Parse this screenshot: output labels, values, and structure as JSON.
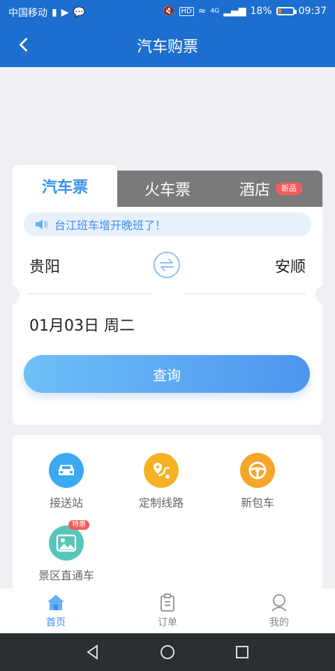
{
  "status_bar": {
    "carrier": "中国移动",
    "battery_percent": "18%",
    "time": "09:37",
    "network": "4G",
    "hd_label": "HD"
  },
  "header": {
    "title": "汽车购票"
  },
  "tabs": {
    "bus": "汽车票",
    "train": "火车票",
    "hotel": "酒店",
    "hotel_badge": "新品"
  },
  "notice": "台江班车增开晚班了！",
  "route": {
    "from": "贵阳",
    "to": "安顺"
  },
  "date": "01月03日 周二",
  "query_button": "查询",
  "services": [
    {
      "label": "接送站"
    },
    {
      "label": "定制线路"
    },
    {
      "label": "新包车"
    },
    {
      "label": "景区直通车",
      "tag": "特惠"
    }
  ],
  "bottom_tabs": [
    {
      "label": "首页",
      "active": true
    },
    {
      "label": "订单",
      "active": false
    },
    {
      "label": "我的",
      "active": false
    }
  ],
  "colors": {
    "accent": "#3b8ef0",
    "header_bg": "#1c6ecf",
    "badge_red": "#f55c5c"
  }
}
